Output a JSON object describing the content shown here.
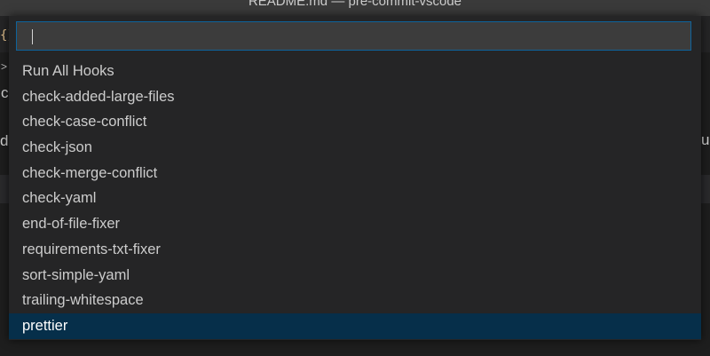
{
  "window": {
    "title": "README.md — pre-commit-vscode"
  },
  "editor": {
    "fragments": {
      "braces": "{}",
      "chevron": ">",
      "line_c": "c",
      "line_d": "d",
      "right_sliver": "u"
    }
  },
  "quick_pick": {
    "input_value": "",
    "items": [
      "Run All Hooks",
      "check-added-large-files",
      "check-case-conflict",
      "check-json",
      "check-merge-conflict",
      "check-yaml",
      "end-of-file-fixer",
      "requirements-txt-fixer",
      "sort-simple-yaml",
      "trailing-whitespace",
      "prettier"
    ],
    "selected_index": 10
  },
  "colors": {
    "title_bar": "#3a3a3a",
    "quick_pick_bg": "#252526",
    "input_bg": "#3c3c3c",
    "focus_border": "#0e639c",
    "selection_bg": "#062f4a",
    "text": "#cccccc"
  }
}
